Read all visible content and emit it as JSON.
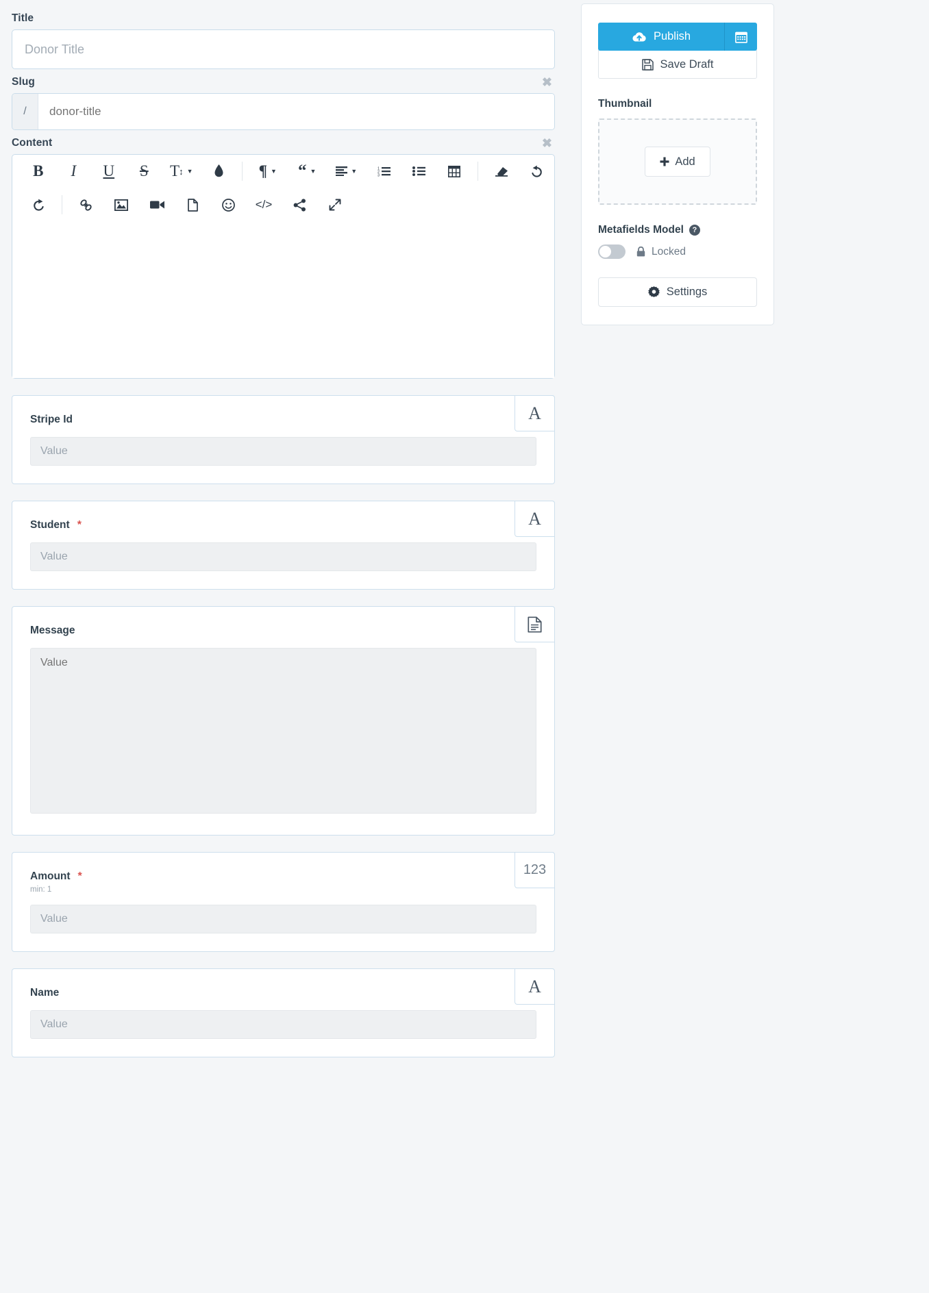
{
  "form": {
    "title": {
      "label": "Title",
      "placeholder": "Donor Title",
      "value": ""
    },
    "slug": {
      "label": "Slug",
      "prefix": "/",
      "placeholder": "donor-title",
      "value": "",
      "remove_label": "✖"
    },
    "content": {
      "label": "Content",
      "value": "",
      "remove_label": "✖"
    }
  },
  "editor_toolbar": {
    "row1": [
      {
        "name": "bold-icon",
        "glyph": "B",
        "style": "bold-serif"
      },
      {
        "name": "italic-icon",
        "glyph": "I",
        "style": "italic-serif"
      },
      {
        "name": "underline-icon",
        "glyph": "U",
        "style": "underline-serif"
      },
      {
        "name": "strikethrough-icon",
        "glyph": "S",
        "style": "strike-serif"
      },
      {
        "name": "font-size-icon",
        "glyph": "T↕",
        "style": "serif-caret"
      },
      {
        "name": "text-color-icon",
        "glyph": "◆",
        "style": "droplet"
      },
      {
        "name": "paragraph-format-icon",
        "glyph": "¶",
        "style": "serif-caret"
      },
      {
        "name": "quote-icon",
        "glyph": "“",
        "style": "serif-caret"
      },
      {
        "name": "align-icon",
        "glyph": "☰",
        "style": "caret"
      },
      {
        "name": "ordered-list-icon",
        "glyph": "1.",
        "style": "svg"
      },
      {
        "name": "unordered-list-icon",
        "glyph": "•",
        "style": "svg"
      },
      {
        "name": "table-icon",
        "glyph": "▦",
        "style": "svg"
      },
      {
        "name": "clear-formatting-icon",
        "glyph": "▱",
        "style": "svg"
      },
      {
        "name": "undo-icon",
        "glyph": "↶",
        "style": "svg"
      }
    ],
    "row2": [
      {
        "name": "redo-icon",
        "glyph": "↻",
        "style": "svg"
      },
      {
        "name": "insert-link-icon",
        "glyph": "🔗",
        "style": "svg"
      },
      {
        "name": "insert-image-icon",
        "glyph": "🖼",
        "style": "svg"
      },
      {
        "name": "insert-video-icon",
        "glyph": "🎥",
        "style": "svg"
      },
      {
        "name": "insert-file-icon",
        "glyph": "📄",
        "style": "svg"
      },
      {
        "name": "emoticon-icon",
        "glyph": "☺",
        "style": "svg"
      },
      {
        "name": "code-view-icon",
        "glyph": "</>",
        "style": "text"
      },
      {
        "name": "share-icon",
        "glyph": "➦",
        "style": "svg"
      },
      {
        "name": "fullscreen-icon",
        "glyph": "↗",
        "style": "svg"
      }
    ]
  },
  "metafields": [
    {
      "label": "Stripe Id",
      "required": false,
      "hint": "",
      "type_badge": "A",
      "type_name": "text",
      "input_kind": "input",
      "placeholder": "Value",
      "value": ""
    },
    {
      "label": "Student",
      "required": true,
      "required_mark": "*",
      "hint": "",
      "type_badge": "A",
      "type_name": "text",
      "input_kind": "input",
      "placeholder": "Value",
      "value": ""
    },
    {
      "label": "Message",
      "required": false,
      "hint": "",
      "type_badge": "🗋",
      "type_name": "textarea",
      "input_kind": "textarea",
      "placeholder": "Value",
      "value": ""
    },
    {
      "label": "Amount",
      "required": true,
      "required_mark": "*",
      "hint": "min: 1",
      "type_badge": "123",
      "type_name": "number",
      "input_kind": "input",
      "placeholder": "Value",
      "value": ""
    },
    {
      "label": "Name",
      "required": false,
      "hint": "",
      "type_badge": "A",
      "type_name": "text",
      "input_kind": "input",
      "placeholder": "Value",
      "value": ""
    }
  ],
  "sidebar": {
    "publish_label": "Publish",
    "schedule_icon": "calendar-icon",
    "save_draft_label": "Save Draft",
    "thumbnail_label": "Thumbnail",
    "add_label": "Add",
    "metafields_model_label": "Metafields Model",
    "help_glyph": "?",
    "locked_label": "Locked",
    "toggle_state": "off",
    "settings_label": "Settings"
  },
  "colors": {
    "accent": "#28a8e0",
    "page_bg": "#f4f6f8",
    "card_border": "#cddfed",
    "required": "#d9534f",
    "muted_text": "#9aa4ae"
  }
}
